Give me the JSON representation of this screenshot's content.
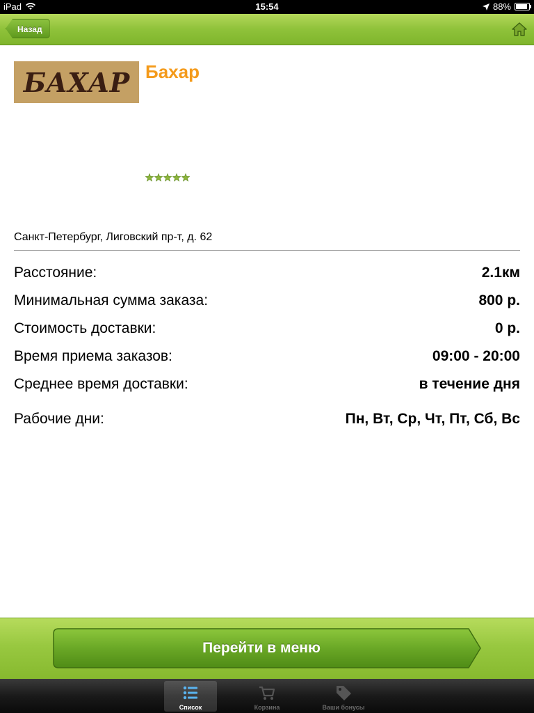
{
  "status_bar": {
    "device": "iPad",
    "time": "15:54",
    "battery": "88%",
    "battery_level": 0.88
  },
  "nav": {
    "back_label": "Назад",
    "home_icon": "home-icon"
  },
  "restaurant": {
    "logo_text": "БАХАР",
    "name": "Бахар",
    "rating": 5,
    "rating_max": 5,
    "address": "Санкт-Петербург, Лиговский пр-т, д. 62"
  },
  "details": [
    {
      "label": "Расстояние:",
      "value": "2.1км"
    },
    {
      "label": "Минимальная сумма заказа:",
      "value": "800 р."
    },
    {
      "label": "Стоимость доставки:",
      "value": "0 р."
    },
    {
      "label": "Время приема заказов:",
      "value": "09:00 - 20:00"
    },
    {
      "label": "Среднее время доставки:",
      "value": "в течение дня"
    },
    {
      "label": "Рабочие дни:",
      "value": "Пн, Вт, Ср, Чт, Пт, Сб, Вс"
    }
  ],
  "action": {
    "menu_button_label": "Перейти в меню"
  },
  "tabs": [
    {
      "label": "Список",
      "icon": "list-icon",
      "active": true
    },
    {
      "label": "Корзина",
      "icon": "cart-icon",
      "active": false
    },
    {
      "label": "Ваши бонусы",
      "icon": "tag-icon",
      "active": false
    }
  ],
  "colors": {
    "accent_green": "#8fc23a",
    "name_orange": "#f49a1a",
    "star_green": "#8cb43a"
  }
}
